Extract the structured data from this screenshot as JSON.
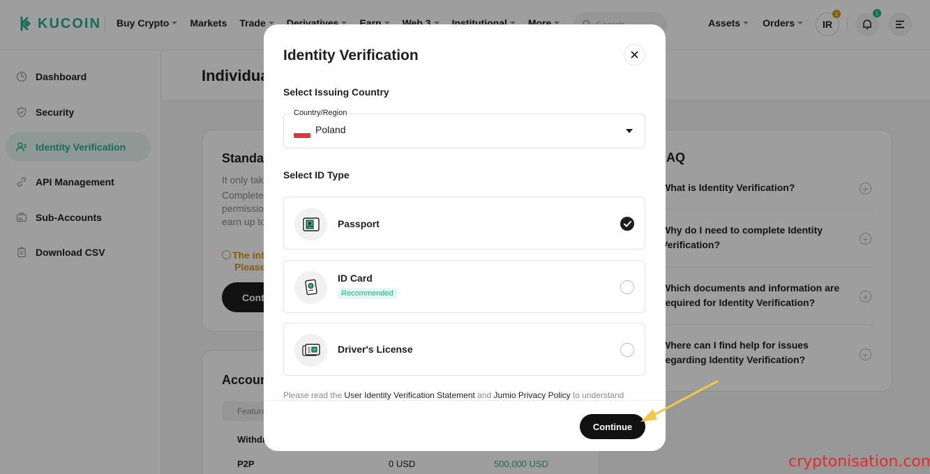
{
  "header": {
    "logo_text": "KUCOIN",
    "nav": [
      {
        "label": "Buy Crypto",
        "dropdown": true
      },
      {
        "label": "Markets",
        "dropdown": false
      },
      {
        "label": "Trade",
        "dropdown": true
      },
      {
        "label": "Derivatives",
        "dropdown": true
      },
      {
        "label": "Earn",
        "dropdown": true
      },
      {
        "label": "Web 3",
        "dropdown": true
      },
      {
        "label": "Institutional",
        "dropdown": true
      },
      {
        "label": "More",
        "dropdown": true
      }
    ],
    "search_placeholder": "Search",
    "assets_label": "Assets",
    "orders_label": "Orders",
    "avatar_initials": "IR",
    "avatar_badge": "1",
    "bell_badge": "1"
  },
  "sidebar": {
    "items": [
      {
        "label": "Dashboard",
        "icon": "dashboard-icon",
        "active": false
      },
      {
        "label": "Security",
        "icon": "shield-icon",
        "active": false
      },
      {
        "label": "Identity Verification",
        "icon": "user-check-icon",
        "active": true
      },
      {
        "label": "API Management",
        "icon": "link-icon",
        "active": false
      },
      {
        "label": "Sub-Accounts",
        "icon": "sub-accounts-icon",
        "active": false
      },
      {
        "label": "Download CSV",
        "icon": "clipboard-icon",
        "active": false
      }
    ]
  },
  "page": {
    "title": "Individua",
    "standard_card": {
      "title": "Standar",
      "desc_1": "It only tak",
      "desc_2": "Complete",
      "desc_3": "permissio",
      "desc_4": "earn up to",
      "warn_1": "The int",
      "warn_2": "Please",
      "button": "Conti"
    },
    "account_card": {
      "title": "Accoun",
      "table_header": "Feature",
      "row1_label": "Withdr",
      "row2_label": "P2P",
      "row2_value": "0 USD",
      "row2_limit": "500,000 USD"
    },
    "faq": {
      "title": "AQ",
      "items": [
        {
          "line1": "What is Identity Verification?",
          "line2": ""
        },
        {
          "line1": "Why do I need to complete Identity",
          "line2": "Verification?"
        },
        {
          "line1": "Which documents and information are",
          "line2": "required for Identity Verification?"
        },
        {
          "line1": "Where can I find help for issues",
          "line2": "regarding Identity Verification?"
        }
      ]
    }
  },
  "modal": {
    "title": "Identity Verification",
    "close_icon": "close-icon",
    "country_section_label": "Select Issuing Country",
    "country_field_label": "Country/Region",
    "country_value": "Poland",
    "id_type_label": "Select ID Type",
    "options": [
      {
        "label": "Passport",
        "tag": "",
        "selected": true,
        "icon": "passport-icon"
      },
      {
        "label": "ID Card",
        "tag": "Recommended",
        "selected": false,
        "icon": "id-card-icon"
      },
      {
        "label": "Driver's License",
        "tag": "",
        "selected": false,
        "icon": "drivers-license-icon"
      }
    ],
    "note_prefix": "Please read the ",
    "note_link1": "User Identity Verification Statement",
    "note_mid": " and ",
    "note_link2": "Jumio Privacy Policy",
    "note_suffix": " to understand",
    "continue_label": "Continue"
  },
  "watermark": "cryptonisation.com",
  "colors": {
    "brand": "#24ae8f",
    "warning": "#d89614",
    "primary_button": "#111111",
    "watermark": "#e32b2b",
    "annotation_arrow": "#f2c84b"
  }
}
